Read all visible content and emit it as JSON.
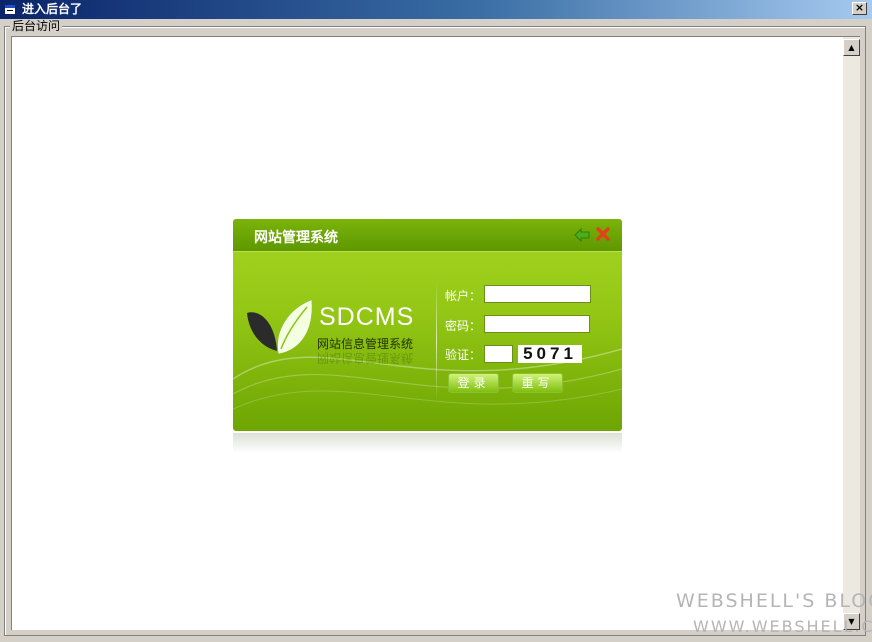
{
  "window": {
    "title": "进入后台了",
    "close_glyph": "×"
  },
  "groupbox": {
    "label": "后台访问"
  },
  "scrollbar": {
    "up_glyph": "▲",
    "down_glyph": "▼"
  },
  "login": {
    "panel_title": "网站管理系统",
    "brand": "SDCMS",
    "brand_subtitle": "网站信息管理系统",
    "username_label": "帐户：",
    "password_label": "密码：",
    "captcha_label": "验证：",
    "username_value": "",
    "password_value": "",
    "captcha_value": "",
    "captcha_image_text": "5071",
    "login_button": "登录",
    "reset_button": "重写"
  },
  "watermark": {
    "line1": "WEBSHELL'S BLOG",
    "line2": "WWW.WEBSHELL.CC"
  },
  "colors": {
    "panel_green": "#93c615",
    "titlebar_blue": "#0a246a"
  }
}
